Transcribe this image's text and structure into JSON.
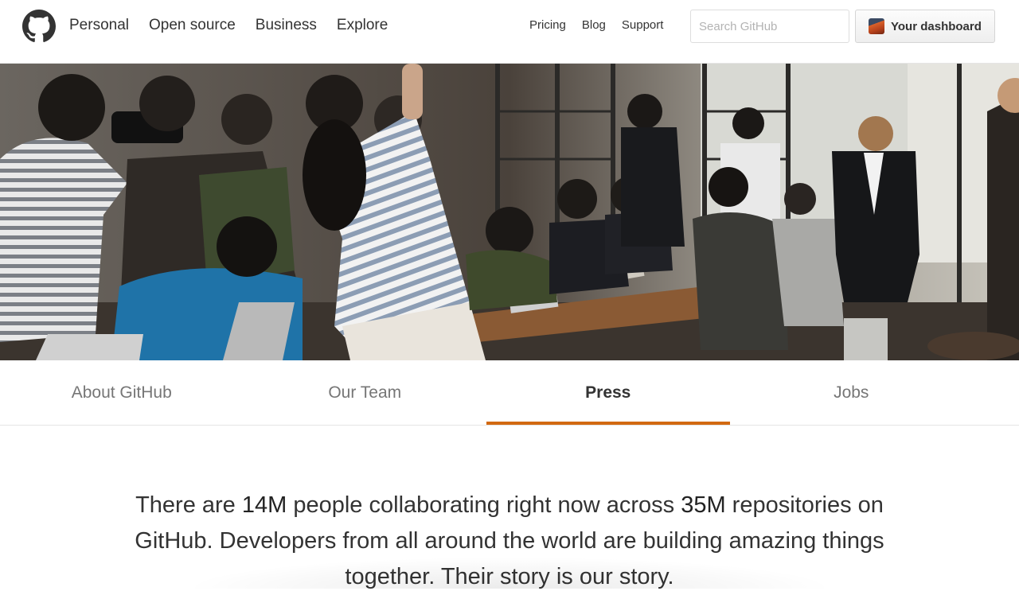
{
  "header": {
    "logo_icon": "github-octocat-icon",
    "main_nav": [
      "Personal",
      "Open source",
      "Business",
      "Explore"
    ],
    "sub_nav": [
      "Pricing",
      "Blog",
      "Support"
    ],
    "search_placeholder": "Search GitHub",
    "dashboard_label": "Your dashboard"
  },
  "hero": {
    "image": "press-photographers-event-photo"
  },
  "tabs": [
    {
      "label": "About GitHub",
      "active": false
    },
    {
      "label": "Our Team",
      "active": false
    },
    {
      "label": "Press",
      "active": true
    },
    {
      "label": "Jobs",
      "active": false
    }
  ],
  "intro": {
    "text_1": "There are ",
    "people": "14M",
    "text_2": " people collaborating right now across ",
    "repos": "35M",
    "text_3": " repositories on GitHub. Developers from all around the world are building amazing things together. Their story is our story."
  },
  "colors": {
    "accent": "#d26911",
    "text": "#333333",
    "muted": "#767676"
  }
}
